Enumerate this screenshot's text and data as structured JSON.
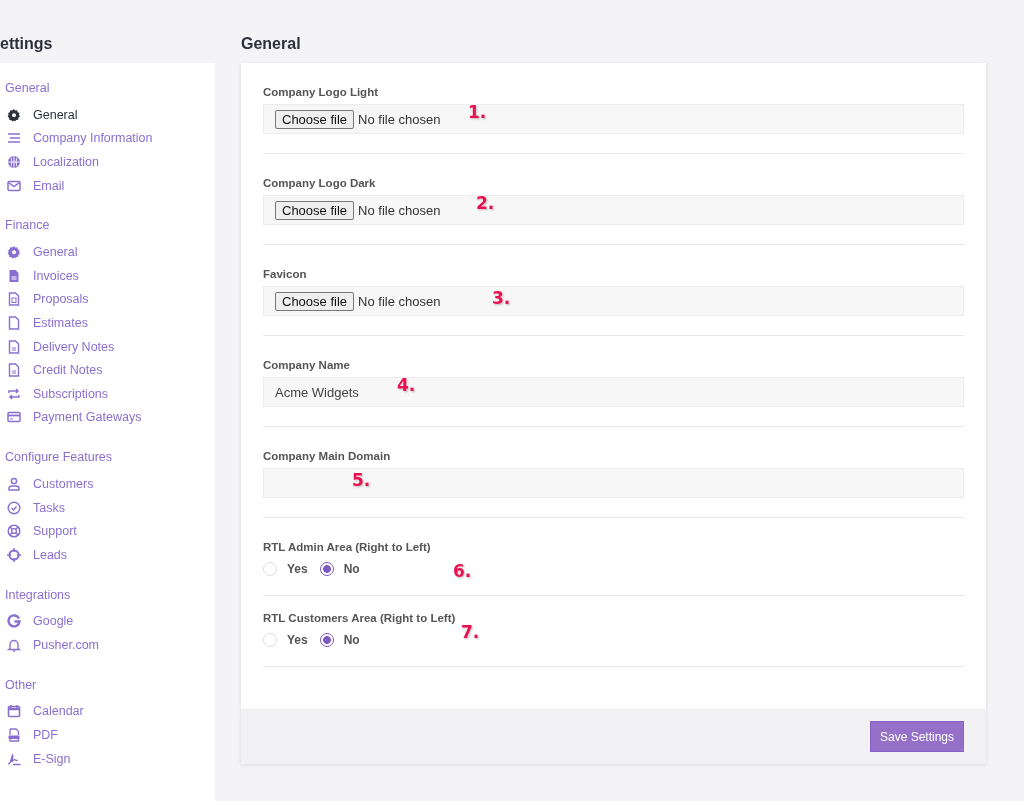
{
  "page_title": "ettings",
  "sidebar": {
    "sections": [
      {
        "heading": "General",
        "items": [
          {
            "label": "General",
            "selected": true
          },
          {
            "label": "Company Information",
            "selected": false
          },
          {
            "label": "Localization",
            "selected": false
          },
          {
            "label": "Email",
            "selected": false
          }
        ]
      },
      {
        "heading": "Finance",
        "items": [
          {
            "label": "General",
            "selected": false
          },
          {
            "label": "Invoices",
            "selected": false
          },
          {
            "label": "Proposals",
            "selected": false
          },
          {
            "label": "Estimates",
            "selected": false
          },
          {
            "label": "Delivery Notes",
            "selected": false
          },
          {
            "label": "Credit Notes",
            "selected": false
          },
          {
            "label": "Subscriptions",
            "selected": false
          },
          {
            "label": "Payment Gateways",
            "selected": false
          }
        ]
      },
      {
        "heading": "Configure Features",
        "items": [
          {
            "label": "Customers",
            "selected": false
          },
          {
            "label": "Tasks",
            "selected": false
          },
          {
            "label": "Support",
            "selected": false
          },
          {
            "label": "Leads",
            "selected": false
          }
        ]
      },
      {
        "heading": "Integrations",
        "items": [
          {
            "label": "Google",
            "selected": false
          },
          {
            "label": "Pusher.com",
            "selected": false
          }
        ]
      },
      {
        "heading": "Other",
        "items": [
          {
            "label": "Calendar",
            "selected": false
          },
          {
            "label": "PDF",
            "selected": false
          },
          {
            "label": "E-Sign",
            "selected": false
          }
        ]
      }
    ]
  },
  "main": {
    "title": "General",
    "fields": [
      {
        "kind": "file",
        "label": "Company Logo Light",
        "button": "Choose file",
        "status": "No file chosen",
        "callout": "1."
      },
      {
        "kind": "file",
        "label": "Company Logo Dark",
        "button": "Choose file",
        "status": "No file chosen",
        "callout": "2."
      },
      {
        "kind": "file",
        "label": "Favicon",
        "button": "Choose file",
        "status": "No file chosen",
        "callout": "3."
      },
      {
        "kind": "text",
        "label": "Company Name",
        "value": "Acme Widgets",
        "callout": "4."
      },
      {
        "kind": "text",
        "label": "Company Main Domain",
        "callout": "5."
      },
      {
        "kind": "radio",
        "label": "RTL Admin Area (Right to Left)",
        "options": [
          {
            "label": "Yes",
            "selected": false
          },
          {
            "label": "No",
            "selected": true
          }
        ],
        "callout": "6."
      },
      {
        "kind": "radio",
        "label": "RTL Customers Area (Right to Left)",
        "options": [
          {
            "label": "Yes",
            "selected": false
          },
          {
            "label": "No",
            "selected": true
          }
        ],
        "callout": "7."
      }
    ],
    "save_button": "Save Settings"
  }
}
